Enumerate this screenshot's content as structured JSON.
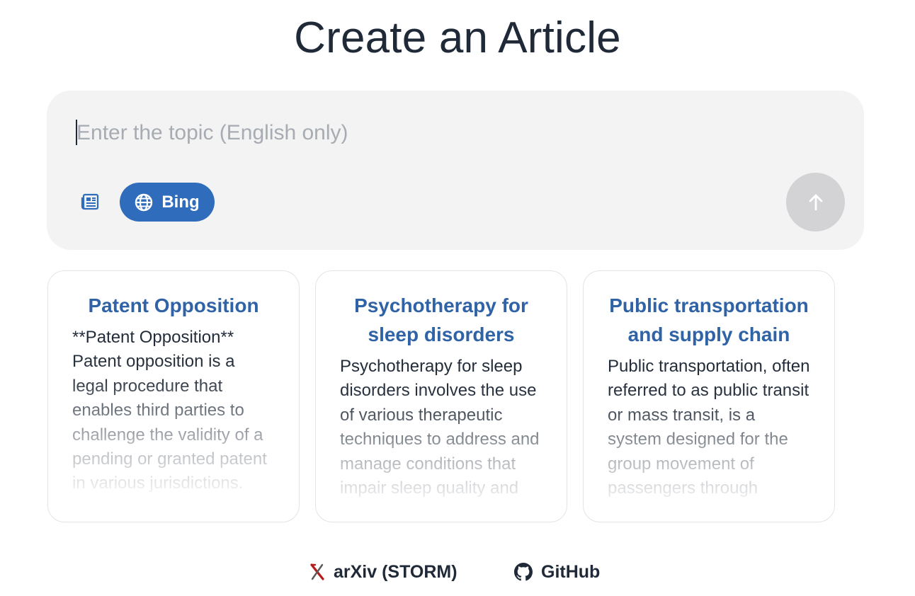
{
  "page": {
    "title": "Create an Article"
  },
  "search": {
    "placeholder": "Enter the topic (English only)",
    "value": "",
    "search_engine_label": "Bing",
    "icons": {
      "news_toggle": "newspaper-icon",
      "engine": "globe-icon",
      "submit": "arrow-up-icon"
    }
  },
  "colors": {
    "accent": "#2f6cbb",
    "card_title": "#2f63a6",
    "panel_bg": "#f3f3f3",
    "submit_disabled": "#d3d3d6"
  },
  "cards": [
    {
      "title": "Patent Opposition",
      "body": "**Patent Opposition** Patent opposition is a legal procedure that enables third parties to challenge the validity of a pending or granted patent in various jurisdictions. This"
    },
    {
      "title": "Psychotherapy for sleep disorders",
      "body": "Psychotherapy for sleep disorders involves the use of various therapeutic techniques to address and manage conditions that impair sleep quality and"
    },
    {
      "title": "Public transportation and supply chain",
      "body": "Public transportation, often referred to as public transit or mass transit, is a system designed for the group movement of passengers through various modes"
    }
  ],
  "footer": {
    "links": [
      {
        "label": "arXiv (STORM)",
        "icon": "arxiv-logo-icon"
      },
      {
        "label": "GitHub",
        "icon": "github-icon"
      }
    ]
  }
}
